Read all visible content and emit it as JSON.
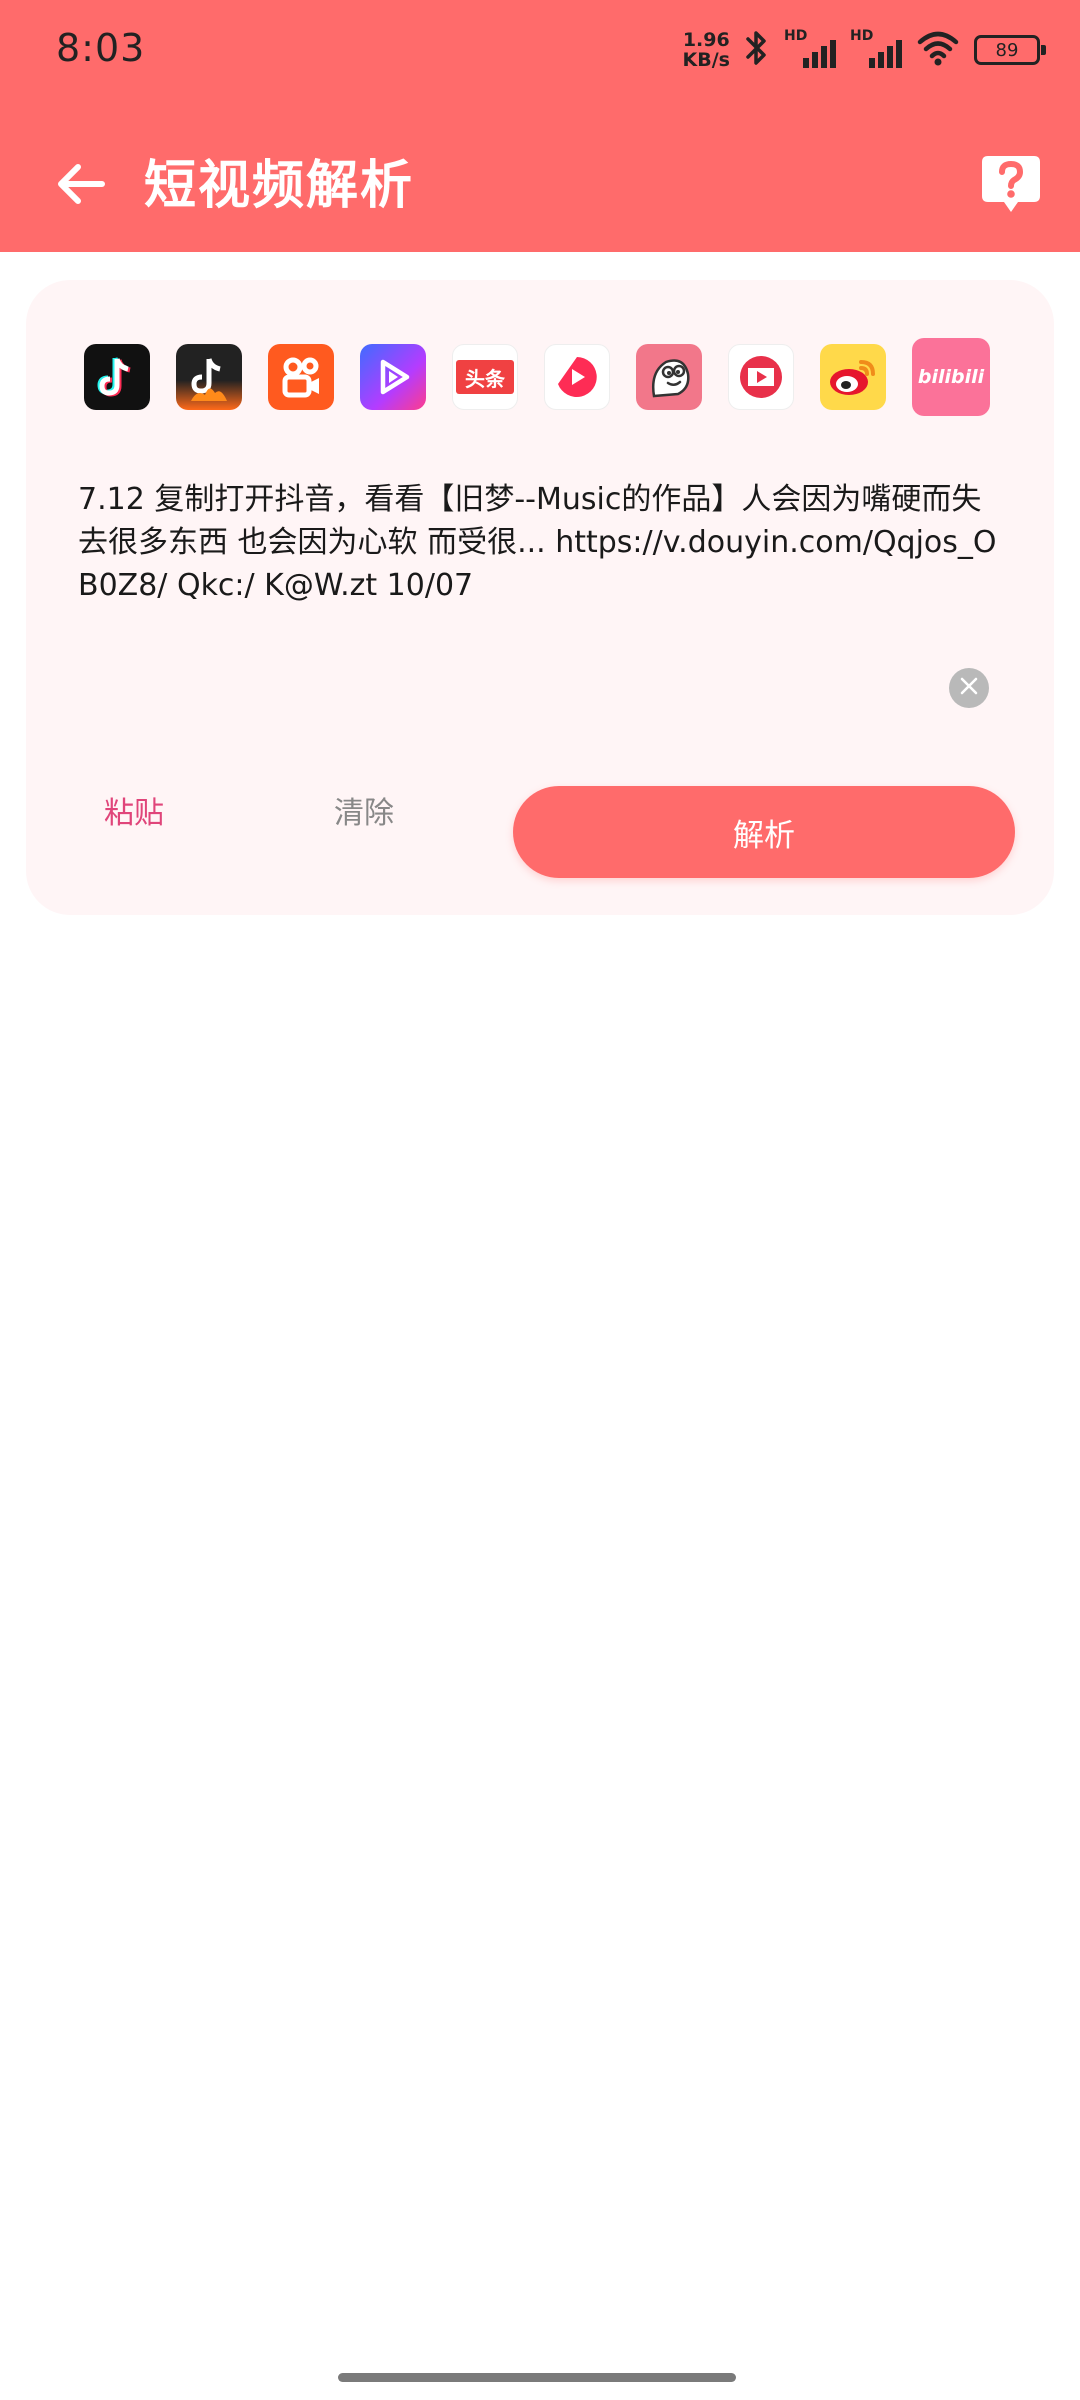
{
  "status_bar": {
    "time": "8:03",
    "net_speed_value": "1.96",
    "net_speed_unit": "KB/s",
    "sim1_label": "HD",
    "sim2_label": "HD",
    "battery": "89"
  },
  "header": {
    "title": "短视频解析",
    "background": "#FF6B6B",
    "back_icon": "arrow-left-icon",
    "help_icon": "question-bubble-icon"
  },
  "platforms": [
    {
      "id": "tiktok",
      "icon": "tiktok-icon"
    },
    {
      "id": "douyin-huoshan",
      "icon": "douyin-flame-icon"
    },
    {
      "id": "kuaishou",
      "icon": "kuaishou-icon"
    },
    {
      "id": "weishi",
      "icon": "play-gradient-icon"
    },
    {
      "id": "toutiao",
      "icon": "toutiao-icon",
      "text": "头条"
    },
    {
      "id": "xigua",
      "icon": "xigua-icon"
    },
    {
      "id": "pipixia",
      "icon": "pipixia-icon"
    },
    {
      "id": "video-red",
      "icon": "red-video-icon"
    },
    {
      "id": "weibo",
      "icon": "weibo-icon"
    },
    {
      "id": "bilibili",
      "icon": "bilibili-icon",
      "text": "bilibili"
    }
  ],
  "input": {
    "value": "7.12 复制打开抖音，看看【旧梦--Music的作品】人会因为嘴硬而失去很多东西 也会因为心软 而受很... https://v.douyin.com/Qqjos_OB0Z8/ Qkc:/ K@W.zt 10/07"
  },
  "actions": {
    "paste": "粘贴",
    "clear": "清除",
    "parse": "解析"
  },
  "colors": {
    "accent": "#FF6B6B",
    "paste_text": "#E0457A",
    "card_bg": "#FFF5F6"
  }
}
